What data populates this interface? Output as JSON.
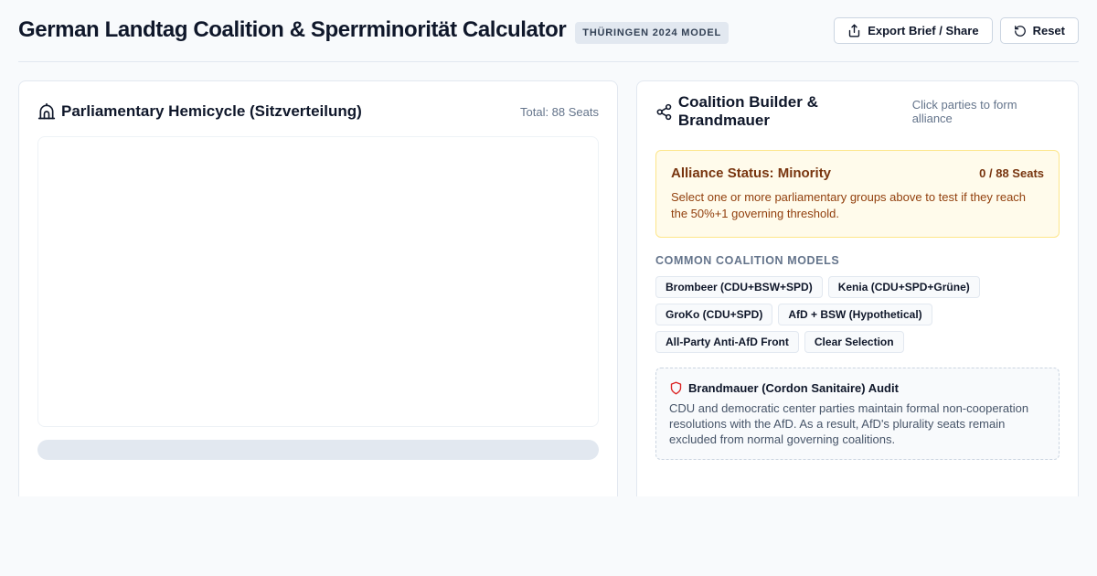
{
  "header": {
    "title": "German Landtag Coalition & Sperrminorität Calculator",
    "badge": "THÜRINGEN 2024 MODEL",
    "export_label": "Export Brief / Share",
    "reset_label": "Reset"
  },
  "hemicycle_panel": {
    "title": "Parliamentary Hemicycle (Sitzverteilung)",
    "total": "Total: 88 Seats",
    "bar_fill_fraction": 0
  },
  "coalition_panel": {
    "title": "Coalition Builder & Brandmauer",
    "hint": "Click parties to form alliance",
    "status": {
      "title": "Alliance Status: Minority",
      "seats": "0 / 88 Seats",
      "description": "Select one or more parliamentary groups above to test if they reach the 50%+1 governing threshold."
    },
    "models_label": "COMMON COALITION MODELS",
    "models": [
      "Brombeer (CDU+BSW+SPD)",
      "Kenia (CDU+SPD+Grüne)",
      "GroKo (CDU+SPD)",
      "AfD + BSW (Hypothetical)",
      "All-Party Anti-AfD Front",
      "Clear Selection"
    ],
    "audit": {
      "title": "Brandmauer (Cordon Sanitaire) Audit",
      "description": "CDU and democratic center parties maintain formal non-cooperation resolutions with the AfD. As a result, AfD's plurality seats remain excluded from normal governing coalitions."
    }
  },
  "colors": {
    "accent": "#0f172a",
    "warning_bg": "#fffbeb",
    "warning_text": "#78350f",
    "shield_red": "#dc2626"
  },
  "icons": {
    "export": "share-icon",
    "reset": "refresh-icon",
    "hemicycle": "parliament-dome-icon",
    "coalition": "network-share-icon",
    "audit": "shield-icon"
  }
}
